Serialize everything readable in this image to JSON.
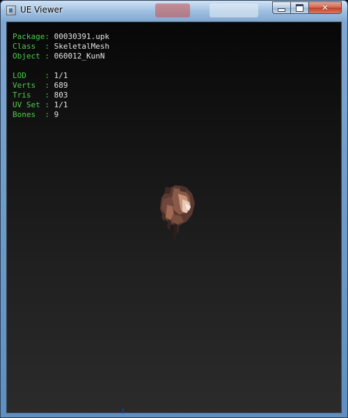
{
  "window": {
    "title": "UE Viewer",
    "controls": {
      "minimize_icon": "minimize-icon",
      "maximize_icon": "maximize-icon",
      "close_icon": "close-icon",
      "close_glyph": "✕"
    }
  },
  "info": {
    "package": {
      "label": "Package:",
      "value": "00030391.upk"
    },
    "class": {
      "label": "Class  :",
      "value": "SkeletalMesh"
    },
    "object": {
      "label": "Object :",
      "value": "060012_KunN"
    },
    "lod": {
      "label": "LOD    :",
      "value": "1/1"
    },
    "verts": {
      "label": "Verts  :",
      "value": "689"
    },
    "tris": {
      "label": "Tris   :",
      "value": "803"
    },
    "uvset": {
      "label": "UV Set :",
      "value": "1/1"
    },
    "bones": {
      "label": "Bones  :",
      "value": "9"
    }
  },
  "colors": {
    "label_green": "#4ccf4c",
    "value_white": "#e6e6e6",
    "viewport_top": "#070707",
    "viewport_bottom": "#2b2b2b"
  }
}
